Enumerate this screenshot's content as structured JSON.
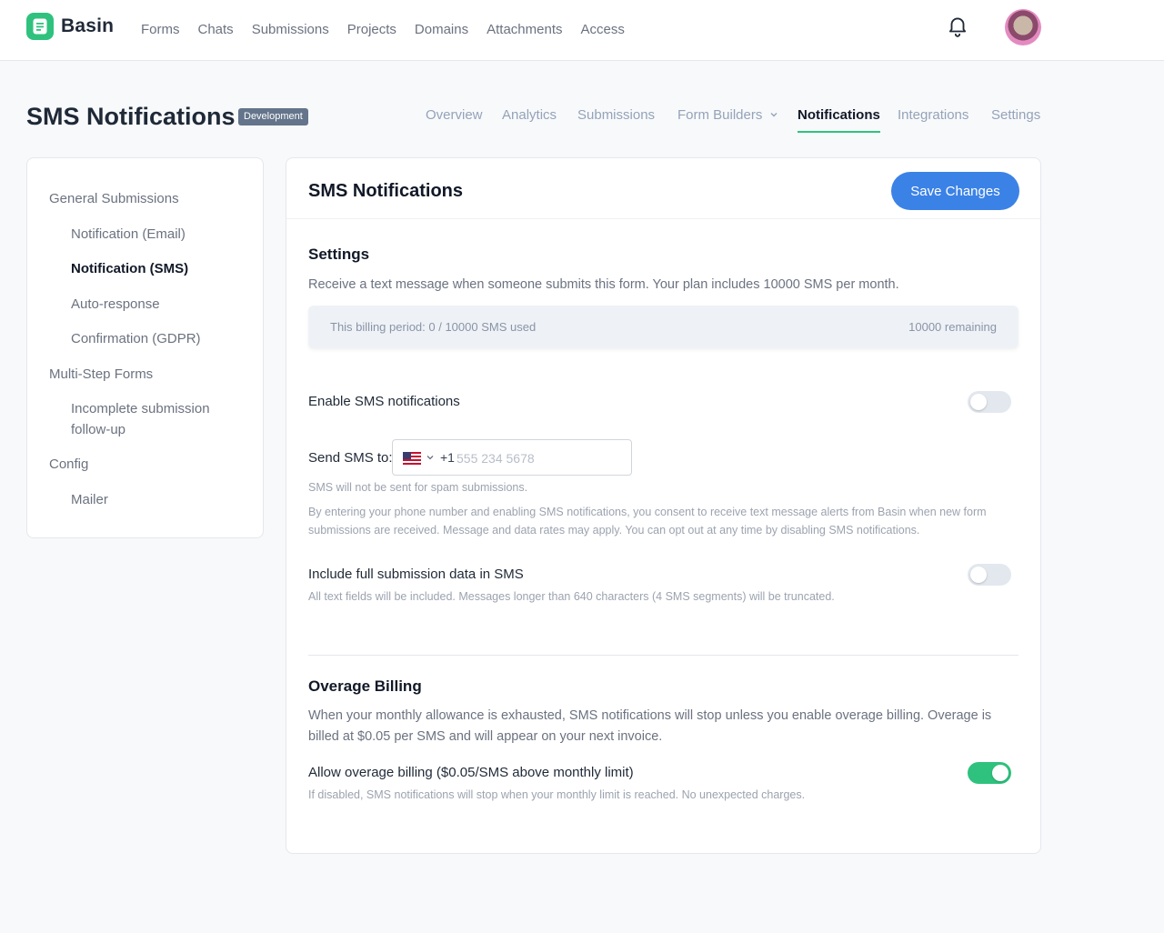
{
  "app": {
    "name": "Basin",
    "nav": [
      "Forms",
      "Chats",
      "Submissions",
      "Projects",
      "Domains",
      "Attachments",
      "Access"
    ]
  },
  "page": {
    "title": "SMS Notifications",
    "env_badge": "Development",
    "tabs": [
      {
        "label": "Overview"
      },
      {
        "label": "Analytics"
      },
      {
        "label": "Submissions"
      },
      {
        "label": "Form Builders"
      },
      {
        "label": "Notifications",
        "active": true
      },
      {
        "label": "Integrations"
      },
      {
        "label": "Settings"
      }
    ]
  },
  "sidebar": {
    "items": [
      {
        "label": "General Submissions",
        "level": "group"
      },
      {
        "label": "Notification (Email)",
        "level": "sub"
      },
      {
        "label": "Notification (SMS)",
        "level": "sub",
        "active": true
      },
      {
        "label": "Auto-response",
        "level": "sub"
      },
      {
        "label": "Confirmation (GDPR)",
        "level": "sub"
      },
      {
        "label": "Multi-Step Forms",
        "level": "group"
      },
      {
        "label": "Incomplete submission follow-up",
        "level": "sub"
      },
      {
        "label": "Config",
        "level": "group"
      },
      {
        "label": "Mailer",
        "level": "sub"
      }
    ]
  },
  "card": {
    "title": "SMS Notifications",
    "save_label": "Save Changes",
    "settings": {
      "heading": "Settings",
      "description": "Receive a text message when someone submits this form. Your plan includes 10000 SMS per month.",
      "usage_left": "This billing period: 0 / 10000 SMS used",
      "usage_right": "10000 remaining",
      "enable_label": "Enable SMS notifications",
      "enable_on": false,
      "send_to_label": "Send SMS to:",
      "dial_code": "+1",
      "phone_value": "",
      "phone_placeholder": "555 234 5678",
      "spam_hint": "SMS will not be sent for spam submissions.",
      "consent_hint": "By entering your phone number and enabling SMS notifications, you consent to receive text message alerts from Basin when new form submissions are received. Message and data rates may apply. You can opt out at any time by disabling SMS notifications.",
      "full_data_label": "Include full submission data in SMS",
      "full_data_on": false,
      "full_data_hint": "All text fields will be included. Messages longer than 640 characters (4 SMS segments) will be truncated."
    },
    "overage": {
      "heading": "Overage Billing",
      "description": "When your monthly allowance is exhausted, SMS notifications will stop unless you enable overage billing. Overage is billed at $0.05 per SMS and will appear on your next invoice.",
      "allow_label": "Allow overage billing ($0.05/SMS above monthly limit)",
      "allow_on": true,
      "allow_hint": "If disabled, SMS notifications will stop when your monthly limit is reached. No unexpected charges."
    }
  },
  "colors": {
    "brand": "#2fc27e",
    "primary_button": "#3b82e6",
    "toggle_off": "#e3e8ef"
  },
  "icons": {
    "logo": "basin-logo-icon",
    "notifications": "bell-icon",
    "country": "us-flag-icon",
    "dropdown": "chevron-down-icon"
  }
}
